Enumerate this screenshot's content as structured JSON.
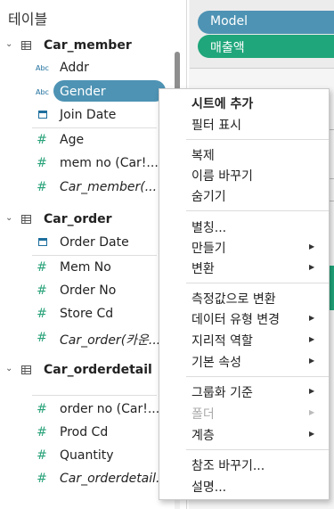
{
  "panel": {
    "title": "테이블",
    "tables": [
      {
        "name": "Car_member",
        "fields": [
          {
            "label": "Addr",
            "icon": "abc"
          },
          {
            "label": "Gender",
            "icon": "abc",
            "selected": true
          },
          {
            "label": "Join Date",
            "icon": "calendar"
          },
          {
            "label": "Age",
            "icon": "hash"
          },
          {
            "label": "mem no (Car!...",
            "icon": "hash"
          },
          {
            "label": "Car_member(...",
            "icon": "hash",
            "italic": true
          }
        ]
      },
      {
        "name": "Car_order",
        "fields": [
          {
            "label": "Order Date",
            "icon": "calendar"
          },
          {
            "label": "Mem No",
            "icon": "hash"
          },
          {
            "label": "Order No",
            "icon": "hash"
          },
          {
            "label": "Store Cd",
            "icon": "hash"
          },
          {
            "label": "Car_order(카운...",
            "icon": "hash",
            "italic": true
          }
        ]
      },
      {
        "name": "Car_orderdetail",
        "fields": [
          {
            "label": "order no (Car!...",
            "icon": "hash"
          },
          {
            "label": "Prod Cd",
            "icon": "hash"
          },
          {
            "label": "Quantity",
            "icon": "hash"
          },
          {
            "label": "Car_orderdetail...",
            "icon": "hash",
            "italic": true
          }
        ]
      }
    ]
  },
  "shelves": {
    "rows_pill": "Model",
    "measure_pill": "매출액",
    "color_blue": "#4e93b4",
    "color_green": "#1fa67a"
  },
  "menu": {
    "items": [
      {
        "label": "시트에 추가",
        "bold": true
      },
      {
        "label": "필터 표시"
      },
      {
        "label": "복제"
      },
      {
        "label": "이름 바꾸기"
      },
      {
        "label": "숨기기"
      },
      {
        "label": "별칭..."
      },
      {
        "label": "만들기",
        "submenu": true
      },
      {
        "label": "변환",
        "submenu": true
      },
      {
        "label": "측정값으로 변환"
      },
      {
        "label": "데이터 유형 변경",
        "submenu": true
      },
      {
        "label": "지리적 역할",
        "submenu": true
      },
      {
        "label": "기본 속성",
        "submenu": true
      },
      {
        "label": "그룹화 기준",
        "submenu": true
      },
      {
        "label": "폴더",
        "submenu": true,
        "disabled": true
      },
      {
        "label": "계층",
        "submenu": true
      },
      {
        "label": "참조 바꾸기..."
      },
      {
        "label": "설명..."
      }
    ]
  }
}
